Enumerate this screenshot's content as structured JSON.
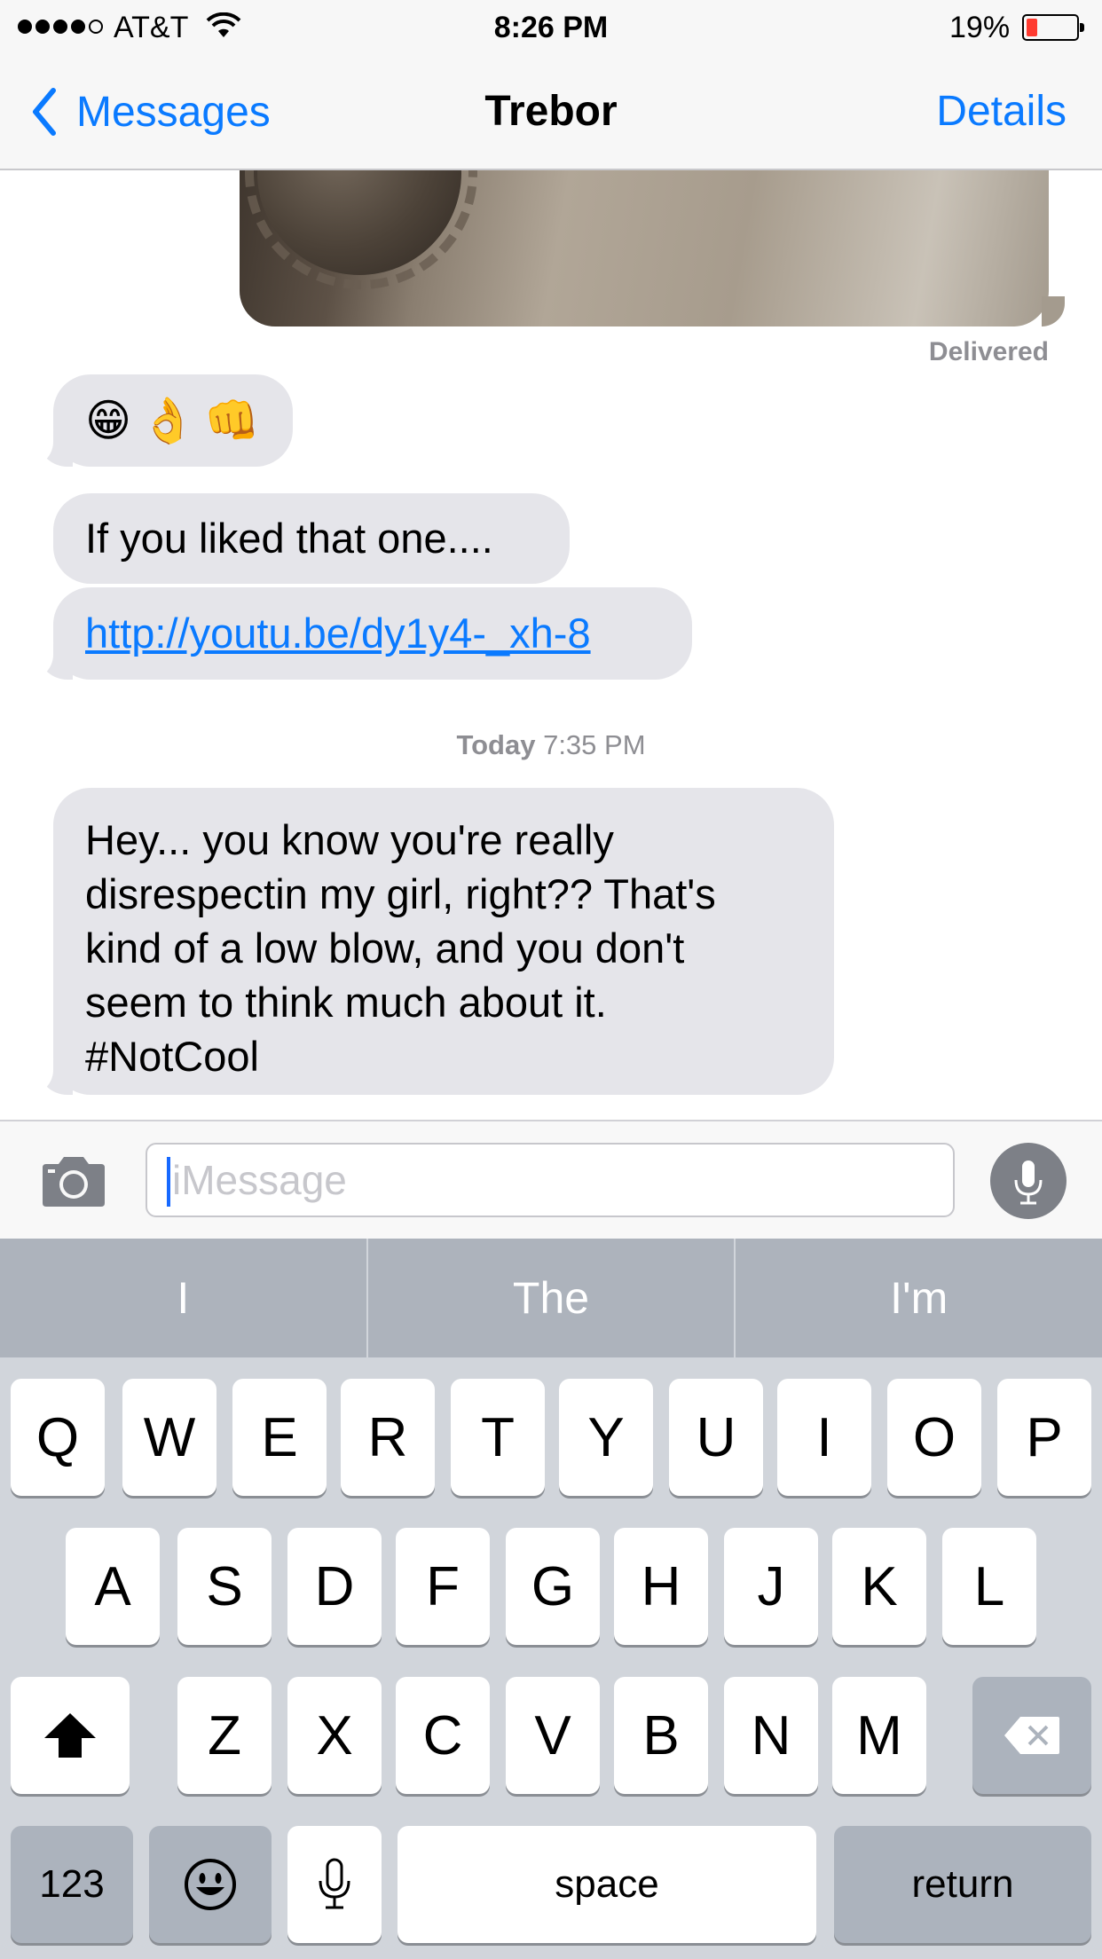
{
  "status_bar": {
    "carrier": "AT&T",
    "time": "8:26 PM",
    "battery_percent": "19%",
    "battery_level": 0.19,
    "signal_bars": 4
  },
  "nav": {
    "back_label": "Messages",
    "title": "Trebor",
    "details_label": "Details"
  },
  "conversation": {
    "delivered": "Delivered",
    "emoji_message": [
      "😁",
      "👌",
      "👊"
    ],
    "message_1": "If you liked that one....",
    "link": "http://youtu.be/dy1y4-_xh-8",
    "timestamp_day": "Today",
    "timestamp_time": "7:35 PM",
    "message_2": "Hey... you know you're really\ndisrespectin my girl, right?? That's\nkind of a low blow, and you don't\nseem to think much about it.\n#NotCool"
  },
  "input": {
    "placeholder": "iMessage"
  },
  "keyboard": {
    "suggestions": [
      "I",
      "The",
      "I'm"
    ],
    "row1": [
      "Q",
      "W",
      "E",
      "R",
      "T",
      "Y",
      "U",
      "I",
      "O",
      "P"
    ],
    "row2": [
      "A",
      "S",
      "D",
      "F",
      "G",
      "H",
      "J",
      "K",
      "L"
    ],
    "row3": [
      "Z",
      "X",
      "C",
      "V",
      "B",
      "N",
      "M"
    ],
    "numbers_label": "123",
    "space_label": "space",
    "return_label": "return"
  },
  "colors": {
    "accent": "#0a7aff",
    "bubble_received": "#e5e5ea",
    "battery_low": "#ff3b30"
  }
}
